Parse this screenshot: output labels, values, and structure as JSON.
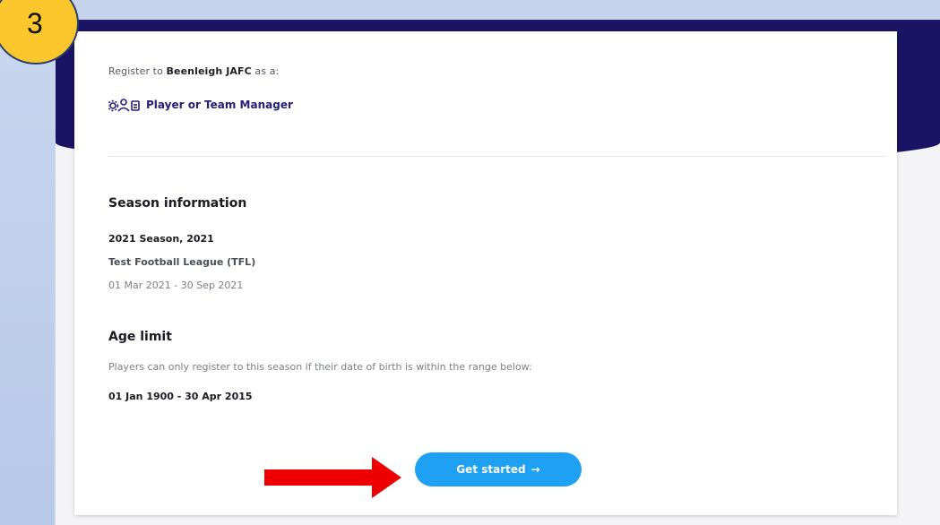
{
  "badge": {
    "number": "3"
  },
  "register": {
    "prefix": "Register to",
    "club": "Beenleigh JAFC",
    "suffix": "as a:",
    "role_label": "Player or Team Manager"
  },
  "season": {
    "heading": "Season information",
    "name": "2021 Season, 2021",
    "league": "Test Football League (TFL)",
    "dates": "01 Mar 2021 - 30 Sep 2021"
  },
  "age_limit": {
    "heading": "Age limit",
    "description": "Players can only register to this season if their date of birth is within the range below:",
    "range": "01 Jan 1900 - 30 Apr 2015"
  },
  "cta": {
    "label": "Get started",
    "arrow": "→"
  },
  "colors": {
    "navy": "#1b1464",
    "button": "#1ea1f2",
    "badge": "#fcc72c",
    "annotation_arrow": "#ee0000"
  },
  "icons": [
    "people-roles-icon",
    "arrow-right-icon",
    "red-pointer-arrow-icon"
  ]
}
